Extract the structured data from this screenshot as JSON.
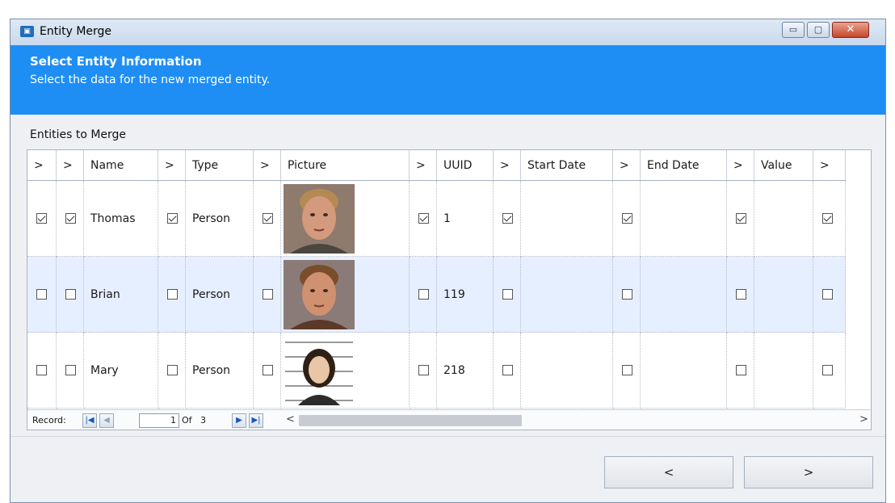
{
  "window": {
    "title": "Entity Merge",
    "controls": {
      "minimize": "▭",
      "maximize": "▢",
      "close": "✕"
    }
  },
  "banner": {
    "title": "Select Entity Information",
    "subtitle": "Select the data for the new merged entity."
  },
  "section": {
    "label": "Entities to Merge"
  },
  "grid": {
    "headers": {
      "sel0": ">",
      "sel1": ">",
      "name": "Name",
      "sel2": ">",
      "type": "Type",
      "sel3": ">",
      "picture": "Picture",
      "sel4": ">",
      "uuid": "UUID",
      "sel5": ">",
      "start_date": "Start Date",
      "sel6": ">",
      "end_date": "End Date",
      "sel7": ">",
      "value": "Value",
      "sel8": ">"
    },
    "rows": [
      {
        "name": "Thomas",
        "type": "Person",
        "uuid": "1",
        "start_date": "",
        "end_date": "",
        "value": "",
        "checked": true,
        "picture": "mugshot-man-older"
      },
      {
        "name": "Brian",
        "type": "Person",
        "uuid": "119",
        "start_date": "",
        "end_date": "",
        "value": "",
        "checked": false,
        "picture": "mugshot-man-young"
      },
      {
        "name": "Mary",
        "type": "Person",
        "uuid": "218",
        "start_date": "",
        "end_date": "",
        "value": "",
        "checked": false,
        "picture": "mugshot-woman-height-chart"
      }
    ]
  },
  "navigator": {
    "label": "Record:",
    "current": "1",
    "of_label": "Of",
    "total": "3",
    "first_icon": "first-record-icon",
    "prev_icon": "prev-record-icon",
    "next_icon": "next-record-icon",
    "last_icon": "last-record-icon",
    "scroll_left": "<",
    "scroll_right": ">"
  },
  "footer": {
    "prev_label": "<",
    "next_label": ">"
  },
  "colors": {
    "banner": "#1e8ef5",
    "alt_row": "#e6efff",
    "titlebar": "#c9d9ec"
  }
}
